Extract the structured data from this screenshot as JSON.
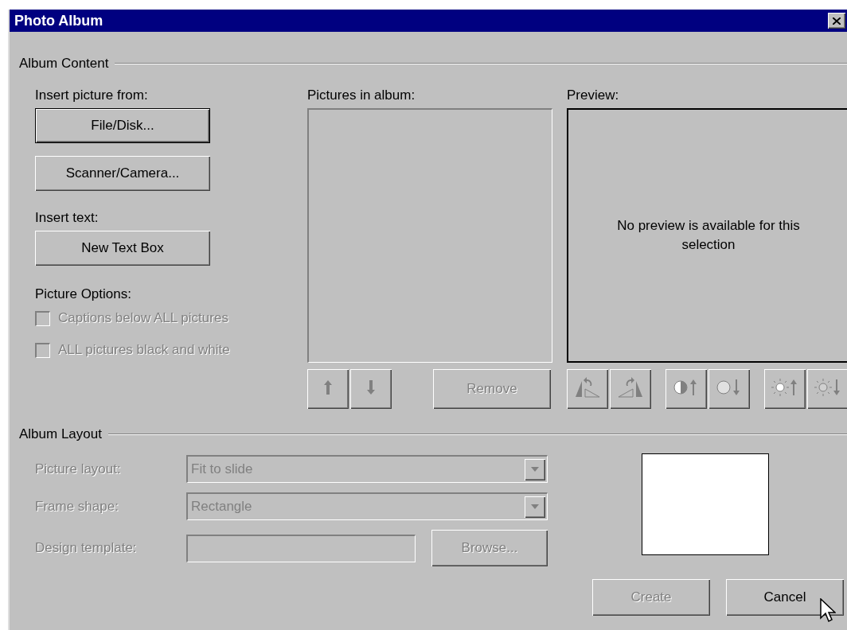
{
  "window": {
    "title": "Photo Album"
  },
  "album_content": {
    "title": "Album Content",
    "insert_picture": {
      "label": "Insert picture from:",
      "buttons": [
        {
          "label": "File/Disk...",
          "focused": true,
          "disabled": false
        },
        {
          "label": "Scanner/Camera...",
          "focused": false,
          "disabled": false
        }
      ]
    },
    "insert_text": {
      "label": "Insert text:",
      "buttons": [
        {
          "label": "New Text Box",
          "focused": false,
          "disabled": false
        }
      ]
    },
    "picture_options": {
      "label": "Picture Options:",
      "options": [
        {
          "label": "Captions below ALL pictures",
          "checked": false,
          "disabled": true
        },
        {
          "label": "ALL pictures black and white",
          "checked": false,
          "disabled": true
        }
      ]
    },
    "pictures_list": {
      "label": "Pictures in album:"
    },
    "order_buttons": [
      {
        "kind": "up",
        "disabled": true
      },
      {
        "kind": "down",
        "disabled": true
      }
    ],
    "remove_button": {
      "label": "Remove",
      "disabled": true
    },
    "preview": {
      "label": "Preview:",
      "message": "No preview is available for this selection"
    },
    "image_tools": [
      {
        "tools": [
          {
            "kind": "rotate-left",
            "disabled": true
          },
          {
            "kind": "rotate-right",
            "disabled": true
          }
        ]
      },
      {
        "tools": [
          {
            "kind": "contrast-up",
            "disabled": true
          },
          {
            "kind": "contrast-down",
            "disabled": true
          }
        ]
      },
      {
        "tools": [
          {
            "kind": "brightness-up",
            "disabled": true
          },
          {
            "kind": "brightness-down",
            "disabled": true
          }
        ]
      }
    ]
  },
  "album_layout": {
    "title": "Album Layout",
    "fields": [
      {
        "kind": "dropdown",
        "label": "Picture layout:",
        "value": "Fit to slide",
        "disabled": true
      },
      {
        "kind": "dropdown",
        "label": "Frame shape:",
        "value": "Rectangle",
        "disabled": true
      },
      {
        "kind": "browse",
        "label": "Design template:",
        "disabled": true,
        "button": {
          "label": "Browse...",
          "disabled": true
        }
      }
    ]
  },
  "buttons": [
    {
      "label": "Create",
      "disabled": true
    },
    {
      "label": "Cancel",
      "disabled": false
    }
  ]
}
